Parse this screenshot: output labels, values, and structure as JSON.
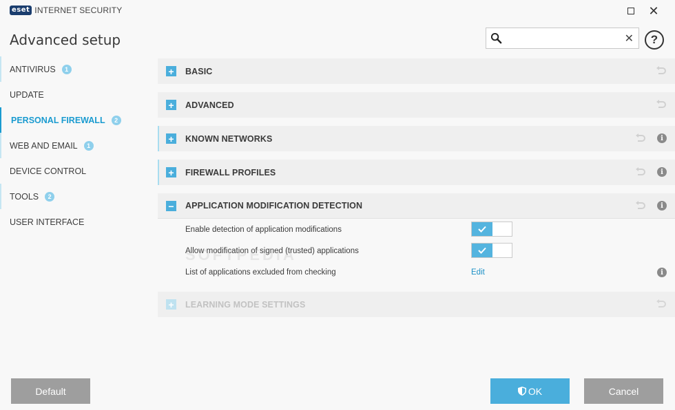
{
  "app": {
    "logo_badge": "eset",
    "logo_text": "INTERNET SECURITY",
    "window_controls": {
      "maximize": "maximize-icon",
      "close": "✕"
    }
  },
  "header": {
    "title": "Advanced setup",
    "search": {
      "value": "",
      "placeholder": "",
      "clear": "✕"
    },
    "help": "?"
  },
  "sidebar": {
    "items": [
      {
        "label": "ANTIVIRUS",
        "badge": "1"
      },
      {
        "label": "UPDATE",
        "badge": ""
      },
      {
        "label": "PERSONAL FIREWALL",
        "badge": "2"
      },
      {
        "label": "WEB AND EMAIL",
        "badge": "1"
      },
      {
        "label": "DEVICE CONTROL",
        "badge": ""
      },
      {
        "label": "TOOLS",
        "badge": "2"
      },
      {
        "label": "USER INTERFACE",
        "badge": ""
      }
    ]
  },
  "sections": [
    {
      "title": "BASIC",
      "expander": "+"
    },
    {
      "title": "ADVANCED",
      "expander": "+"
    },
    {
      "title": "KNOWN NETWORKS",
      "expander": "+",
      "info": "i"
    },
    {
      "title": "FIREWALL PROFILES",
      "expander": "+",
      "info": "i"
    },
    {
      "title": "APPLICATION MODIFICATION DETECTION",
      "expander": "−",
      "info": "i"
    },
    {
      "title": "LEARNING MODE SETTINGS",
      "expander": "+"
    }
  ],
  "settings": [
    {
      "label": "Enable detection of application modifications",
      "enabled": true
    },
    {
      "label": "Allow modification of signed (trusted) applications",
      "enabled": true
    },
    {
      "label": "List of applications excluded from checking",
      "action": "Edit",
      "info": "i"
    }
  ],
  "watermark": "SOFTPEDIA",
  "footer": {
    "default_label": "Default",
    "ok_label": "OK",
    "cancel_label": "Cancel"
  },
  "colors": {
    "accent": "#4aaedc",
    "active_nav": "#1a9bd0",
    "button_gray": "#9e9e9e"
  }
}
